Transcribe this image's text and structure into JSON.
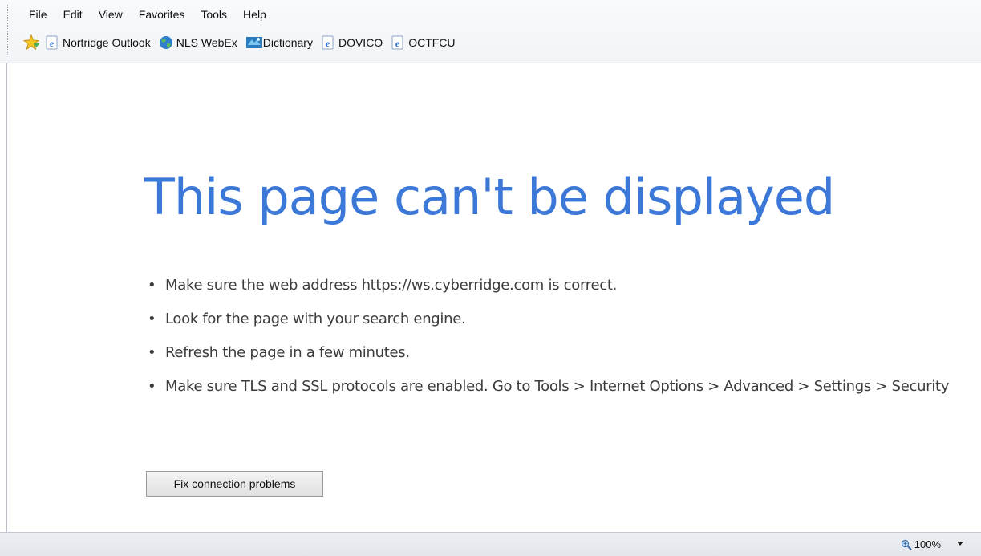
{
  "menubar": {
    "items": [
      "File",
      "Edit",
      "View",
      "Favorites",
      "Tools",
      "Help"
    ]
  },
  "favorites": {
    "links": [
      {
        "label": "Nortridge Outlook",
        "icon": "ie-page-icon"
      },
      {
        "label": "NLS WebEx",
        "icon": "globe-icon"
      },
      {
        "label": "Dictionary",
        "icon": "dictionary-icon"
      },
      {
        "label": "DOVICO",
        "icon": "ie-page-icon"
      },
      {
        "label": "OCTFCU",
        "icon": "ie-page-icon"
      }
    ]
  },
  "error_page": {
    "title": "This page can't be displayed",
    "tips": [
      "Make sure the web address https://ws.cyberridge.com is correct.",
      "Look for the page with your search engine.",
      "Refresh the page in a few minutes.",
      "Make sure TLS and SSL protocols are enabled. Go to Tools > Internet Options > Advanced > Settings > Security"
    ],
    "bullet": "•",
    "fix_button_label": "Fix connection problems"
  },
  "statusbar": {
    "zoom_level": "100%"
  },
  "colors": {
    "title": "#3b78d8",
    "body_text": "#3c3c3c"
  }
}
